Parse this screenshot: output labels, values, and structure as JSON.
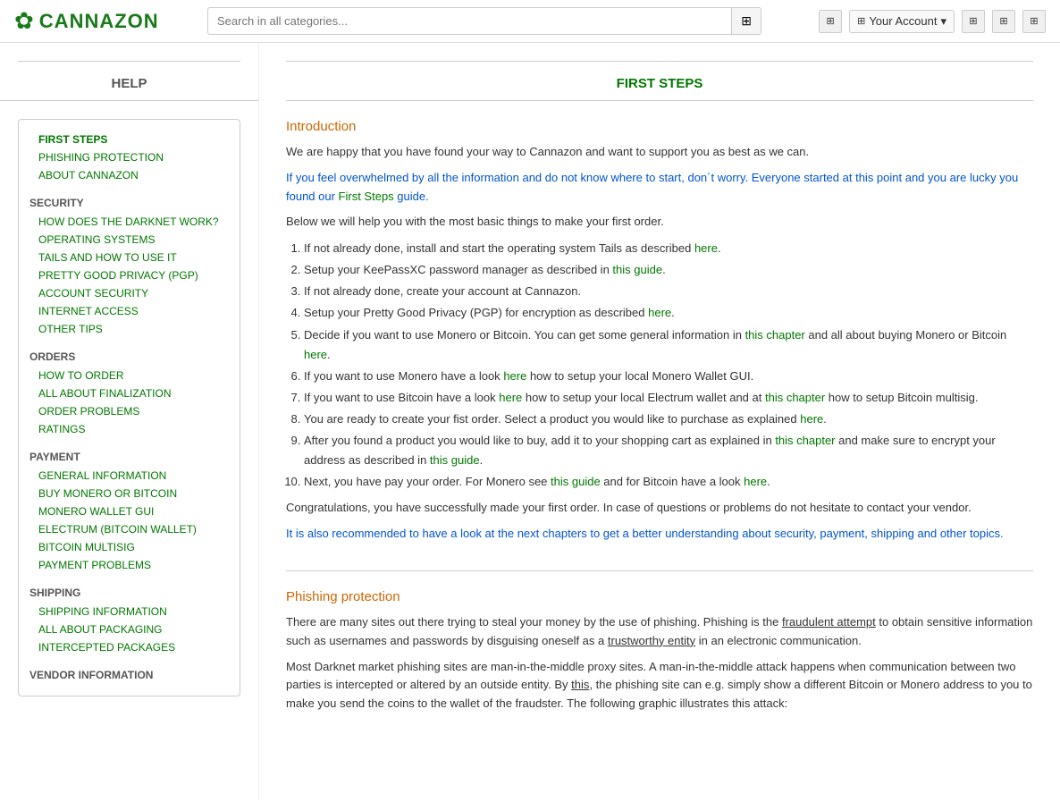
{
  "header": {
    "logo_text": "CANNAZON",
    "search_placeholder": "Search in all categories...",
    "account_label": "Your Account"
  },
  "sidebar": {
    "title": "HELP",
    "sections": [
      {
        "items": [
          {
            "label": "FIRST STEPS",
            "active": true,
            "top_level": true
          },
          {
            "label": "PHISHING PROTECTION",
            "active": false,
            "top_level": true
          },
          {
            "label": "ABOUT CANNAZON",
            "active": false,
            "top_level": true
          }
        ]
      },
      {
        "section_label": "SECURITY",
        "items": [
          {
            "label": "HOW DOES THE DARKNET WORK?"
          },
          {
            "label": "OPERATING SYSTEMS"
          },
          {
            "label": "TAILS AND HOW TO USE IT"
          },
          {
            "label": "PRETTY GOOD PRIVACY (PGP)"
          },
          {
            "label": "ACCOUNT SECURITY"
          },
          {
            "label": "INTERNET ACCESS"
          },
          {
            "label": "OTHER TIPS"
          }
        ]
      },
      {
        "section_label": "ORDERS",
        "items": [
          {
            "label": "HOW TO ORDER"
          },
          {
            "label": "ALL ABOUT FINALIZATION"
          },
          {
            "label": "ORDER PROBLEMS"
          },
          {
            "label": "RATINGS"
          }
        ]
      },
      {
        "section_label": "PAYMENT",
        "items": [
          {
            "label": "GENERAL INFORMATION"
          },
          {
            "label": "BUY MONERO OR BITCOIN"
          },
          {
            "label": "MONERO WALLET GUI"
          },
          {
            "label": "ELECTRUM (BITCOIN WALLET)"
          },
          {
            "label": "BITCOIN MULTISIG"
          },
          {
            "label": "PAYMENT PROBLEMS"
          }
        ]
      },
      {
        "section_label": "SHIPPING",
        "items": [
          {
            "label": "SHIPPING INFORMATION"
          },
          {
            "label": "ALL ABOUT PACKAGING"
          },
          {
            "label": "INTERCEPTED PACKAGES"
          }
        ]
      },
      {
        "section_label": "VENDOR INFORMATION",
        "items": []
      }
    ]
  },
  "main": {
    "title": "FIRST STEPS",
    "sections": [
      {
        "id": "introduction",
        "heading": "Introduction",
        "paragraphs": [
          "We are happy that you have found your way to Cannazon and want to support you as best as we can.",
          "Below we will help you with the most basic things to make your first order."
        ],
        "blue_paragraph": "If you feel overwhelmed by all the information and do not know where to start, don´t worry. Everyone started at this point and you are lucky you found our First Steps guide.",
        "list_items": [
          {
            "text": "If not already done, install and start the operating system Tails as described ",
            "link": "here",
            "rest": "."
          },
          {
            "text": "Setup your KeePassXC password manager as described in ",
            "link": "this guide",
            "rest": "."
          },
          {
            "text": "If not already done, create your account at Cannazon.",
            "link": null,
            "rest": ""
          },
          {
            "text": "Setup your Pretty Good Privacy (PGP) for encryption as described ",
            "link": "here",
            "rest": "."
          },
          {
            "text": "Decide if you want to use Monero or Bitcoin. You can get some general information in ",
            "link": "this chapter",
            "link2": " and all about buying Monero or Bitcoin ",
            "link3": "here",
            "rest": ".",
            "type": "multi"
          },
          {
            "text": "If you want to use Monero have a look ",
            "link": "here",
            "rest": " how to setup your local Monero Wallet GUI.",
            "type": "single"
          },
          {
            "text": "If you want to use Bitcoin have a look ",
            "link": "here",
            "rest": " how to setup your local Electrum wallet and at ",
            "link2": "this chapter",
            "rest2": " how to setup Bitcoin multisig.",
            "type": "multi2"
          },
          {
            "text": "You are ready to create your fist order. Select a product you would like to purchase as explained ",
            "link": "here",
            "rest": "."
          },
          {
            "text": "After you found a product you would like to buy, add it to your shopping cart as explained in ",
            "link": "this chapter",
            "rest": " and make sure to encrypt your address as described in ",
            "link2": "this guide",
            "rest2": ".",
            "type": "multi2"
          },
          {
            "text": "Next, you have pay your order. For Monero see ",
            "link": "this guide",
            "rest": " and for Bitcoin have a look ",
            "link2": "here",
            "rest2": ".",
            "type": "multi2"
          }
        ],
        "congrats": "Congratulations, you have successfully made your first order. In case of questions or problems do not hesitate to contact your vendor.",
        "blue_footer": "It is also recommended to have a look at the next chapters to get a better understanding about security, payment, shipping and other topics."
      },
      {
        "id": "phishing",
        "heading": "Phishing protection",
        "paragraphs": [
          "There are many sites out there trying to steal your money by the use of phishing. Phishing is the fraudulent attempt to obtain sensitive information such as usernames and passwords by disguising oneself as a trustworthy entity in an electronic communication.",
          "Most Darknet market phishing sites are man-in-the-middle proxy sites. A man-in-the-middle attack happens when communication between two parties is intercepted or altered by an outside entity. By this, the phishing site can e.g. simply show a different Bitcoin or Monero address to you to make you send the coins to the wallet of the fraudster. The following graphic illustrates this attack:"
        ]
      }
    ]
  }
}
